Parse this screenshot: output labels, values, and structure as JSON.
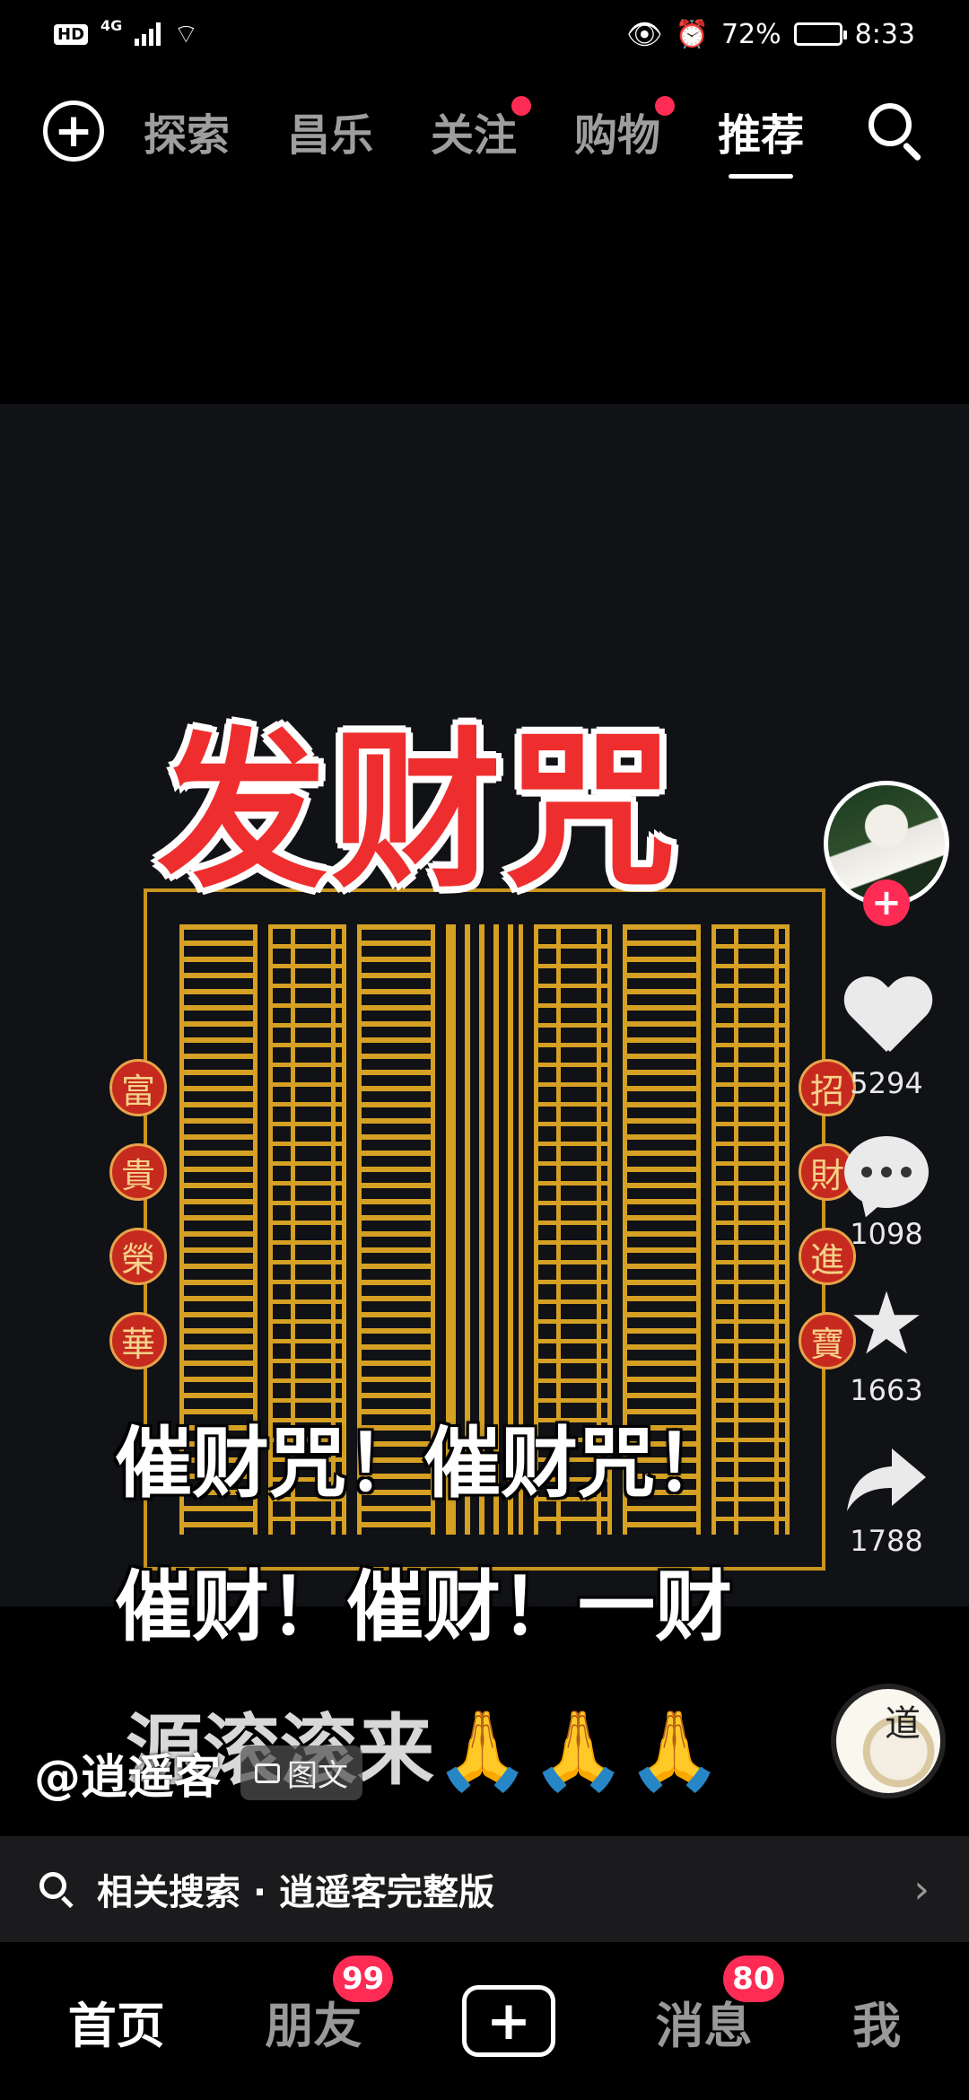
{
  "status_bar": {
    "hd": "HD",
    "network": "4G",
    "battery": "72%",
    "battery_level": 0.72,
    "time": "8:33"
  },
  "top_nav": {
    "tabs": [
      {
        "label": "探索",
        "dot": false
      },
      {
        "label": "昌乐",
        "dot": false
      },
      {
        "label": "关注",
        "dot": true
      },
      {
        "label": "购物",
        "dot": true
      },
      {
        "label": "推荐",
        "dot": false,
        "active": true
      }
    ]
  },
  "video": {
    "title": "发财咒",
    "seals_left": [
      "富",
      "貴",
      "榮",
      "華"
    ],
    "seals_right": [
      "招",
      "財",
      "進",
      "寶"
    ],
    "subtitles": [
      "催财咒！催财咒！",
      "催财！催财！一财",
      "源滚滚来🙏🙏🙏"
    ]
  },
  "actions": {
    "likes": "5294",
    "comments": "1098",
    "favorites": "1663",
    "shares": "1788"
  },
  "author": {
    "name": "@逍遥客",
    "tag": "图文"
  },
  "related_search": {
    "text": "相关搜索 · 逍遥客完整版"
  },
  "bottom_nav": {
    "home": "首页",
    "friends": "朋友",
    "friends_badge": "99",
    "messages": "消息",
    "messages_badge": "80",
    "me": "我"
  },
  "colors": {
    "accent_red": "#fe2c55",
    "title_red": "#ee2e2e",
    "gold": "#e0a824"
  }
}
